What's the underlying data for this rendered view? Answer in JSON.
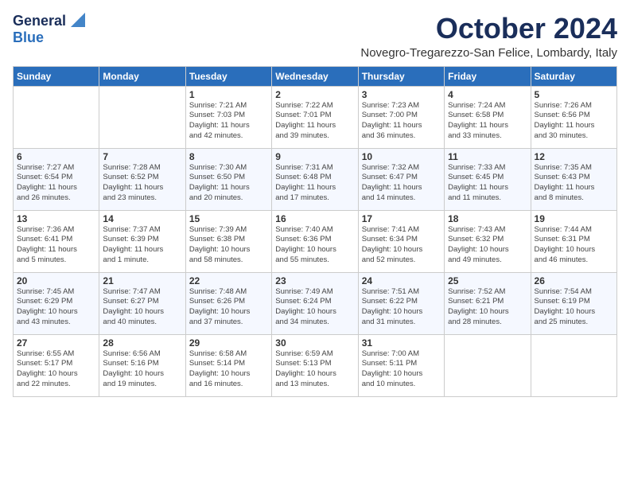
{
  "logo": {
    "general": "General",
    "blue": "Blue"
  },
  "title": "October 2024",
  "location": "Novegro-Tregarezzo-San Felice, Lombardy, Italy",
  "weekdays": [
    "Sunday",
    "Monday",
    "Tuesday",
    "Wednesday",
    "Thursday",
    "Friday",
    "Saturday"
  ],
  "weeks": [
    [
      {
        "day": "",
        "detail": ""
      },
      {
        "day": "",
        "detail": ""
      },
      {
        "day": "1",
        "detail": "Sunrise: 7:21 AM\nSunset: 7:03 PM\nDaylight: 11 hours\nand 42 minutes."
      },
      {
        "day": "2",
        "detail": "Sunrise: 7:22 AM\nSunset: 7:01 PM\nDaylight: 11 hours\nand 39 minutes."
      },
      {
        "day": "3",
        "detail": "Sunrise: 7:23 AM\nSunset: 7:00 PM\nDaylight: 11 hours\nand 36 minutes."
      },
      {
        "day": "4",
        "detail": "Sunrise: 7:24 AM\nSunset: 6:58 PM\nDaylight: 11 hours\nand 33 minutes."
      },
      {
        "day": "5",
        "detail": "Sunrise: 7:26 AM\nSunset: 6:56 PM\nDaylight: 11 hours\nand 30 minutes."
      }
    ],
    [
      {
        "day": "6",
        "detail": "Sunrise: 7:27 AM\nSunset: 6:54 PM\nDaylight: 11 hours\nand 26 minutes."
      },
      {
        "day": "7",
        "detail": "Sunrise: 7:28 AM\nSunset: 6:52 PM\nDaylight: 11 hours\nand 23 minutes."
      },
      {
        "day": "8",
        "detail": "Sunrise: 7:30 AM\nSunset: 6:50 PM\nDaylight: 11 hours\nand 20 minutes."
      },
      {
        "day": "9",
        "detail": "Sunrise: 7:31 AM\nSunset: 6:48 PM\nDaylight: 11 hours\nand 17 minutes."
      },
      {
        "day": "10",
        "detail": "Sunrise: 7:32 AM\nSunset: 6:47 PM\nDaylight: 11 hours\nand 14 minutes."
      },
      {
        "day": "11",
        "detail": "Sunrise: 7:33 AM\nSunset: 6:45 PM\nDaylight: 11 hours\nand 11 minutes."
      },
      {
        "day": "12",
        "detail": "Sunrise: 7:35 AM\nSunset: 6:43 PM\nDaylight: 11 hours\nand 8 minutes."
      }
    ],
    [
      {
        "day": "13",
        "detail": "Sunrise: 7:36 AM\nSunset: 6:41 PM\nDaylight: 11 hours\nand 5 minutes."
      },
      {
        "day": "14",
        "detail": "Sunrise: 7:37 AM\nSunset: 6:39 PM\nDaylight: 11 hours\nand 1 minute."
      },
      {
        "day": "15",
        "detail": "Sunrise: 7:39 AM\nSunset: 6:38 PM\nDaylight: 10 hours\nand 58 minutes."
      },
      {
        "day": "16",
        "detail": "Sunrise: 7:40 AM\nSunset: 6:36 PM\nDaylight: 10 hours\nand 55 minutes."
      },
      {
        "day": "17",
        "detail": "Sunrise: 7:41 AM\nSunset: 6:34 PM\nDaylight: 10 hours\nand 52 minutes."
      },
      {
        "day": "18",
        "detail": "Sunrise: 7:43 AM\nSunset: 6:32 PM\nDaylight: 10 hours\nand 49 minutes."
      },
      {
        "day": "19",
        "detail": "Sunrise: 7:44 AM\nSunset: 6:31 PM\nDaylight: 10 hours\nand 46 minutes."
      }
    ],
    [
      {
        "day": "20",
        "detail": "Sunrise: 7:45 AM\nSunset: 6:29 PM\nDaylight: 10 hours\nand 43 minutes."
      },
      {
        "day": "21",
        "detail": "Sunrise: 7:47 AM\nSunset: 6:27 PM\nDaylight: 10 hours\nand 40 minutes."
      },
      {
        "day": "22",
        "detail": "Sunrise: 7:48 AM\nSunset: 6:26 PM\nDaylight: 10 hours\nand 37 minutes."
      },
      {
        "day": "23",
        "detail": "Sunrise: 7:49 AM\nSunset: 6:24 PM\nDaylight: 10 hours\nand 34 minutes."
      },
      {
        "day": "24",
        "detail": "Sunrise: 7:51 AM\nSunset: 6:22 PM\nDaylight: 10 hours\nand 31 minutes."
      },
      {
        "day": "25",
        "detail": "Sunrise: 7:52 AM\nSunset: 6:21 PM\nDaylight: 10 hours\nand 28 minutes."
      },
      {
        "day": "26",
        "detail": "Sunrise: 7:54 AM\nSunset: 6:19 PM\nDaylight: 10 hours\nand 25 minutes."
      }
    ],
    [
      {
        "day": "27",
        "detail": "Sunrise: 6:55 AM\nSunset: 5:17 PM\nDaylight: 10 hours\nand 22 minutes."
      },
      {
        "day": "28",
        "detail": "Sunrise: 6:56 AM\nSunset: 5:16 PM\nDaylight: 10 hours\nand 19 minutes."
      },
      {
        "day": "29",
        "detail": "Sunrise: 6:58 AM\nSunset: 5:14 PM\nDaylight: 10 hours\nand 16 minutes."
      },
      {
        "day": "30",
        "detail": "Sunrise: 6:59 AM\nSunset: 5:13 PM\nDaylight: 10 hours\nand 13 minutes."
      },
      {
        "day": "31",
        "detail": "Sunrise: 7:00 AM\nSunset: 5:11 PM\nDaylight: 10 hours\nand 10 minutes."
      },
      {
        "day": "",
        "detail": ""
      },
      {
        "day": "",
        "detail": ""
      }
    ]
  ],
  "colors": {
    "header_bg": "#2a6ebb",
    "header_text": "#ffffff",
    "title_color": "#1a2e5a"
  }
}
